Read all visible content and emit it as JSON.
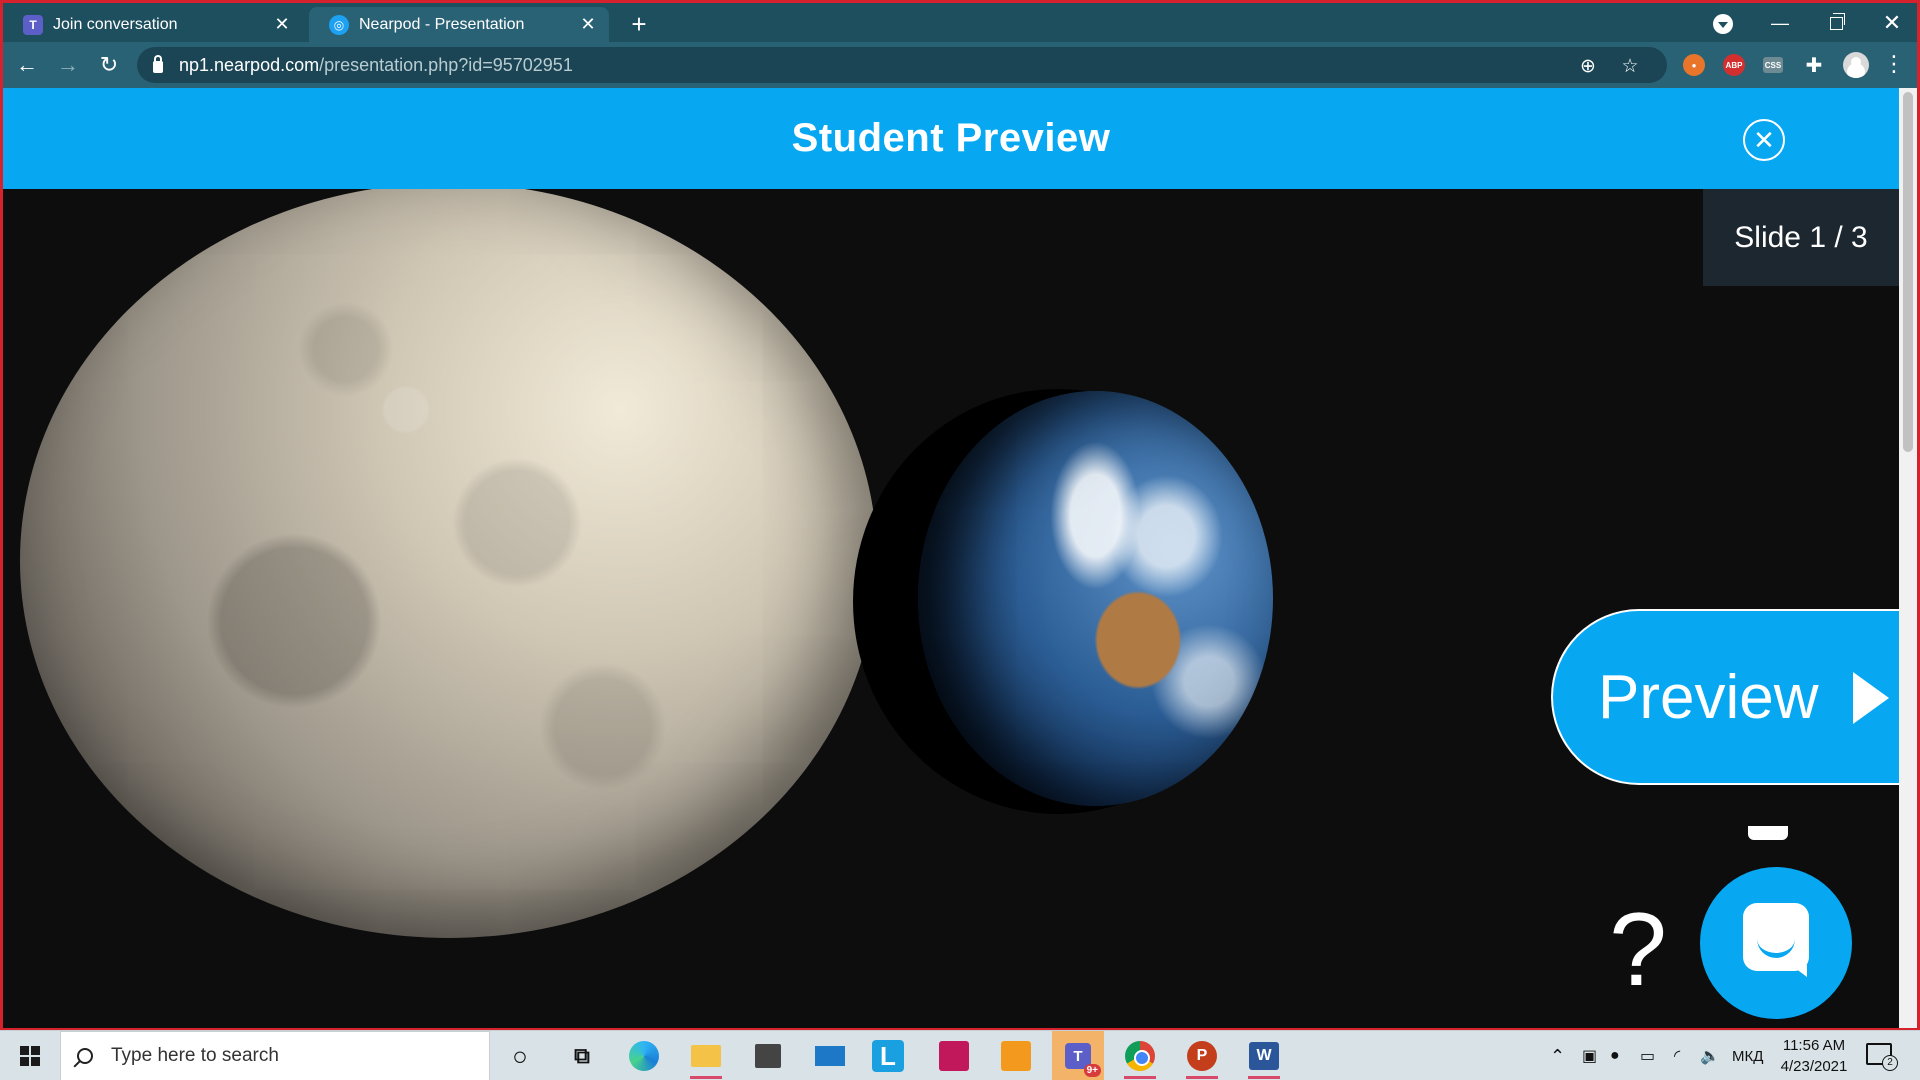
{
  "browser": {
    "tabs": [
      {
        "title": "Join conversation",
        "icon": "teams-icon",
        "active": false
      },
      {
        "title": "Nearpod - Presentation",
        "icon": "nearpod-icon",
        "active": true
      }
    ],
    "new_tab_label": "+",
    "url_host": "np1.nearpod.com",
    "url_path": "/presentation.php?id=95702951",
    "extensions": [
      "fox-extension-icon",
      "adblock-plus-icon",
      "css-extension-icon",
      "puzzle-icon"
    ],
    "ext_abp_label": "ABP",
    "ext_css_label": "CSS",
    "window_controls": {
      "minimize": "—",
      "close": "✕"
    }
  },
  "nearpod": {
    "header_title": "Student Preview",
    "close_glyph": "✕",
    "slide_counter": "Slide 1 / 3",
    "preview_button_label": "Preview",
    "help_glyph": "?",
    "accent_color": "#08a7f2",
    "slide_scene": [
      "moon",
      "earth"
    ]
  },
  "taskbar": {
    "search_placeholder": "Type here to search",
    "apps": [
      "cortana-icon",
      "task-view-icon",
      "edge-icon",
      "file-explorer-icon",
      "store-icon",
      "mail-icon",
      "l-app-icon",
      "pink-app-icon",
      "pinwheel-app-icon",
      "teams-icon",
      "chrome-icon",
      "powerpoint-icon",
      "word-icon"
    ],
    "l_app_label": "L",
    "teams_label": "T",
    "teams_badge": "9+",
    "ppt_label": "P",
    "word_label": "W",
    "language": "МКД",
    "time": "11:56 AM",
    "date": "4/23/2021",
    "notification_count": "2"
  }
}
